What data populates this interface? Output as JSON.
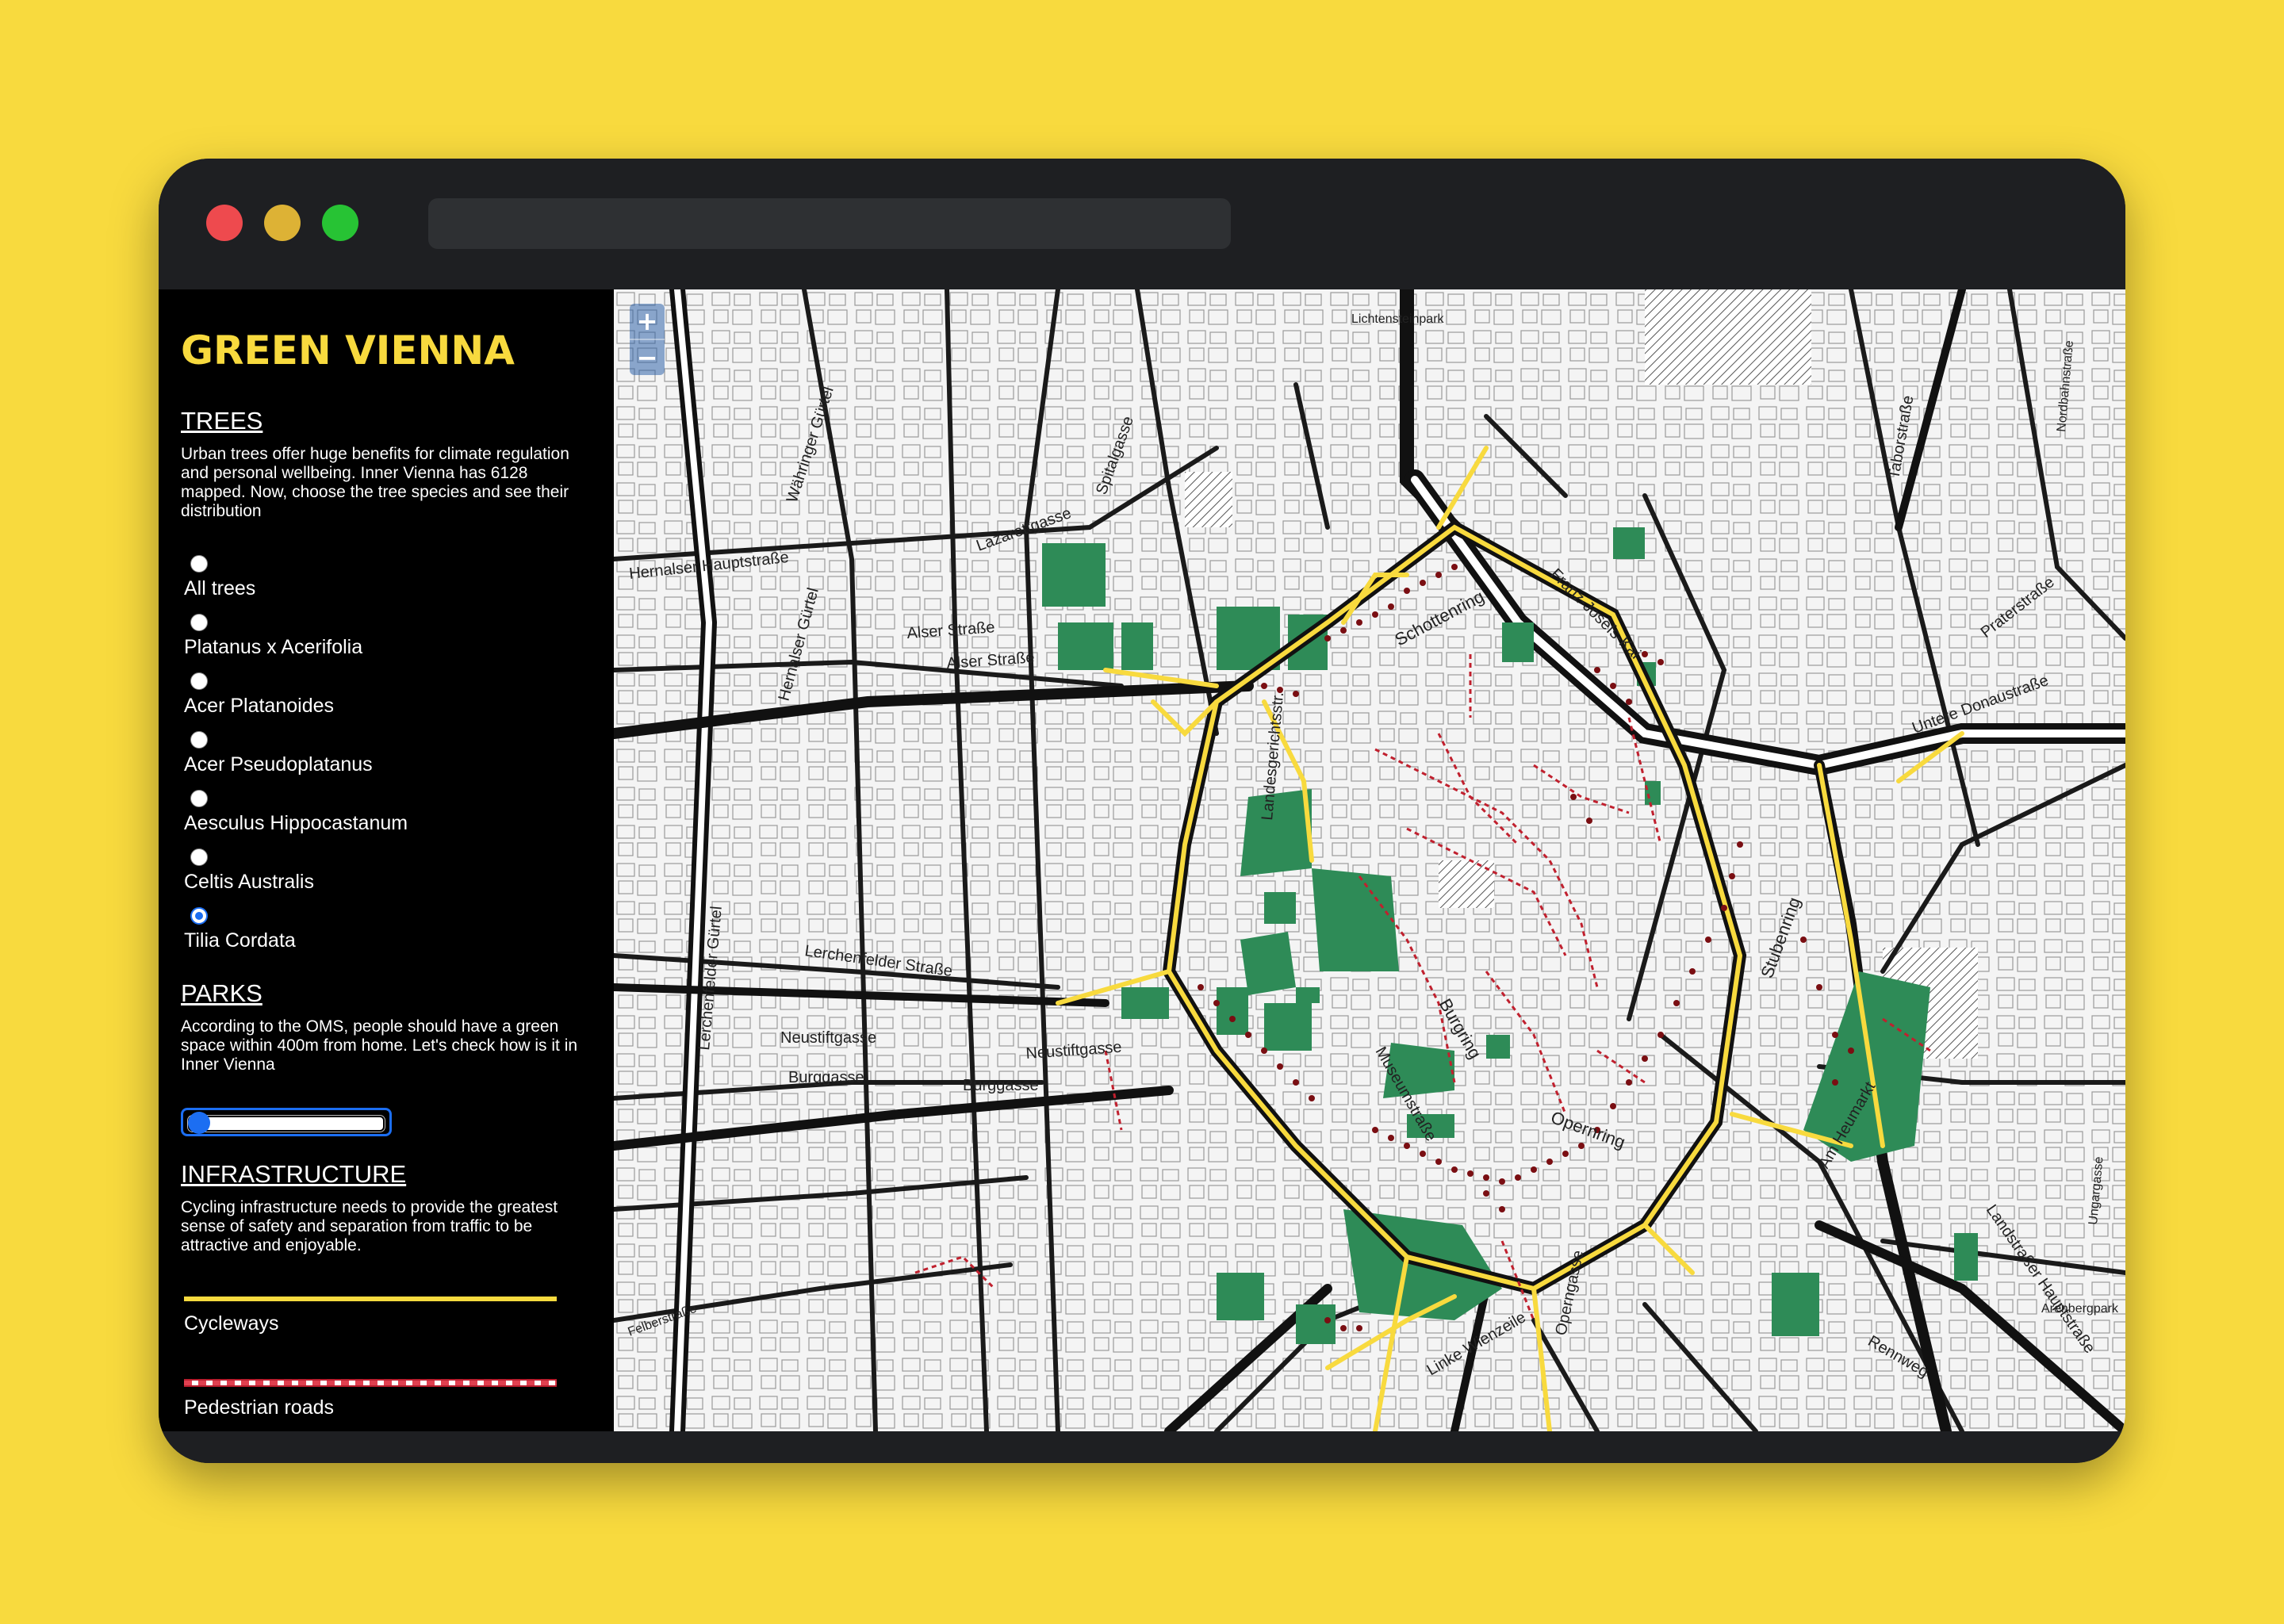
{
  "app": {
    "title": "GREEN VIENNA"
  },
  "window": {
    "traffic_lights": [
      "red-close",
      "yellow-minimize",
      "green-maximize"
    ],
    "url": ""
  },
  "sidebar": {
    "trees": {
      "heading": "TREES",
      "description": "Urban trees offer huge benefits for climate regulation and personal wellbeing. Inner Vienna has 6128 mapped. Now, choose the tree species and see their distribution",
      "options": [
        {
          "label": "All trees",
          "selected": false
        },
        {
          "label": "Platanus x Acerifolia",
          "selected": false
        },
        {
          "label": "Acer Platanoides",
          "selected": false
        },
        {
          "label": "Acer Pseudoplatanus",
          "selected": false
        },
        {
          "label": "Aesculus Hippocastanum",
          "selected": false
        },
        {
          "label": "Celtis Australis",
          "selected": false
        },
        {
          "label": "Tilia Cordata",
          "selected": true
        }
      ]
    },
    "parks": {
      "heading": "PARKS",
      "description": "According to the OMS, people should have a green space within 400m from home. Let's check how is it in Inner Vienna",
      "slider_value": 0
    },
    "infrastructure": {
      "heading": "INFRASTRUCTURE",
      "description": "Cycling infrastructure needs to provide the greatest sense of safety and separation from traffic to be attractive and enjoyable.",
      "legend": [
        {
          "label": "Cycleways",
          "color": "#F8DA3E"
        },
        {
          "label": "Pedestrian roads",
          "color": "#E04050"
        }
      ]
    }
  },
  "map": {
    "zoom_in": "+",
    "zoom_out": "−",
    "labels": {
      "lazarettgasse": "Lazarettgasse",
      "spitalgasse": "Spitalgasse",
      "waehringer_guertel": "Währinger Gürtel",
      "hernalser_hauptstr": "Hernalser Hauptstraße",
      "alser_strasse_1": "Alser Straße",
      "alser_strasse_2": "Alser Straße",
      "hernalser_guertel": "Hernalser Gürtel",
      "lerchenfelder_guertel": "Lerchenfelder Gürtel",
      "lerchenfelder_strasse": "Lerchenfelder Straße",
      "neustiftgasse_1": "Neustiftgasse",
      "neustiftgasse_2": "Neustiftgasse",
      "burggasse_1": "Burggasse",
      "burggasse_2": "Burggasse",
      "landesgerichtsstr": "Landesgerichtsstr.",
      "schottenring": "Schottenring",
      "franz_josefs_kai": "Franz-Josefs-Kai",
      "untere_donaustrasse": "Untere Donaustraße",
      "stubenring": "Stubenring",
      "opernring": "Opernring",
      "burgring": "Burgring",
      "museumstrasse": "Museumstraße",
      "am_heumarkt": "Am Heumarkt",
      "linke_wienzeile": "Linke Wienzeile",
      "operngasse": "Operngasse",
      "rennweg": "Rennweg",
      "landstrasser_hauptstrasse": "Landstraßer Hauptstraße",
      "praterstrasse": "Praterstraße",
      "taborstrasse": "Taborstraße",
      "lichtensteinpark": "Lichtensteinpark",
      "ungargasse": "Ungargasse",
      "felberstrasse": "Felberstraße",
      "arenbergpark": "Arenbergpark",
      "nordbahnstrasse": "Nordbahnstraße"
    },
    "colors": {
      "park": "#2E8B57",
      "cycleway": "#F8DA3E",
      "pedestrian": "#C0202E",
      "tree": "#7A0E12",
      "road": "#111111"
    }
  }
}
